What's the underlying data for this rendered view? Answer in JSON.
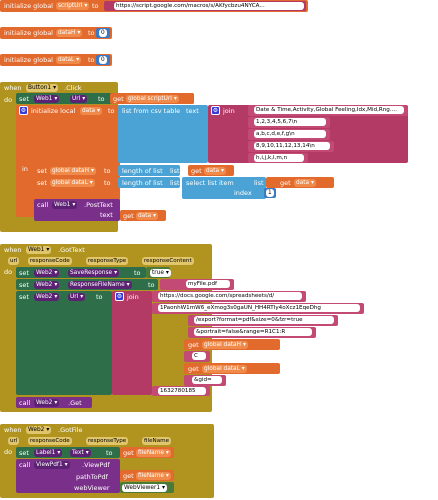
{
  "g1": {
    "kw": "initialize global",
    "name": "scriptUrl",
    "to": "to",
    "value": "https://script.google.com/macros/s/AKfycbzu4NYCA..."
  },
  "g2": {
    "kw": "initialize global",
    "name": "dataH",
    "to": "to",
    "value": "0"
  },
  "g3": {
    "kw": "initialize global",
    "name": "dataL",
    "to": "to",
    "value": "0"
  },
  "e1": {
    "when": "when",
    "comp": "Button1",
    "evt": ".Click",
    "do": "do",
    "set": "set",
    "web": "Web1",
    "prop": "Url",
    "to": "to",
    "get": "get",
    "gvar": "global scriptUrl",
    "initLocal": "initialize local",
    "lname": "data",
    "lto": "to",
    "in": "in",
    "csv": "list from csv table",
    "textKw": "text",
    "join": "join",
    "joinItems": [
      "Date & Time,Activity,Global Feeling,Idx,Mid,Rng....",
      "1,2,3,4,5,6,7\\n",
      "a,b,c,d,e,f,g\\n",
      "8,9,10,11,12,13,14\\n",
      "h,i,j,k,l,m,n"
    ],
    "setDataH": "global dataH",
    "lengthOf": "length of list",
    "listKw": "list",
    "getData": "data",
    "setDataL": "global dataL",
    "select": "select list item",
    "listKw2": "list",
    "indexKw": "index",
    "indexVal": "1",
    "call": "call",
    "postComp": "Web1",
    ".PostText": ".PostText",
    "postText": "text"
  },
  "e2": {
    "when": "when",
    "comp": "Web1",
    "evt": ".GotText",
    "params": [
      "url",
      "responseCode",
      "responseType",
      "responseContent"
    ],
    "do": "do",
    "set": "set",
    "r1": {
      "comp": "Web2",
      "prop": "SaveResponse",
      "to": "to",
      "val": "true"
    },
    "r2": {
      "comp": "Web2",
      "prop": "ResponseFileName",
      "to": "to",
      "val": "myFile.pdf"
    },
    "r3": {
      "comp": "Web2",
      "prop": "Url",
      "to": "to",
      "join": "join"
    },
    "joinItems": [
      "https://docs.google.com/spreadsheets/d/",
      "1PaonhW1mW6_eXmog3s0gaUN_HH4RTIy4oXcz1EqeDhg",
      "/export?format=pdf&size=0&fzr=true",
      "&portrait=false&range=R1C1:R"
    ],
    "getH": "global dataH",
    "cLetter": "C",
    "getL": "global dataL",
    "gid": "&gid=",
    "gidVal": "1632780185",
    "call": "call",
    "callComp": "Web2",
    ".Get": ".Get"
  },
  "e3": {
    "when": "when",
    "comp": "Web2",
    "evt": ".GotFile",
    "params": [
      "url",
      "responseCode",
      "responseType",
      "fileName"
    ],
    "do": "do",
    "set": "set",
    "labelComp": "Label1",
    "labelProp": "Text",
    "to": "to",
    "get": "get",
    "fileName": "fileName",
    "call": "call",
    "viewer": "ViewPdf1",
    ".ViewPdf": ".ViewPdf",
    "pathToPdf": "pathToPdf",
    "webViewer": "webViewer",
    "web1": "WebViewer1"
  }
}
